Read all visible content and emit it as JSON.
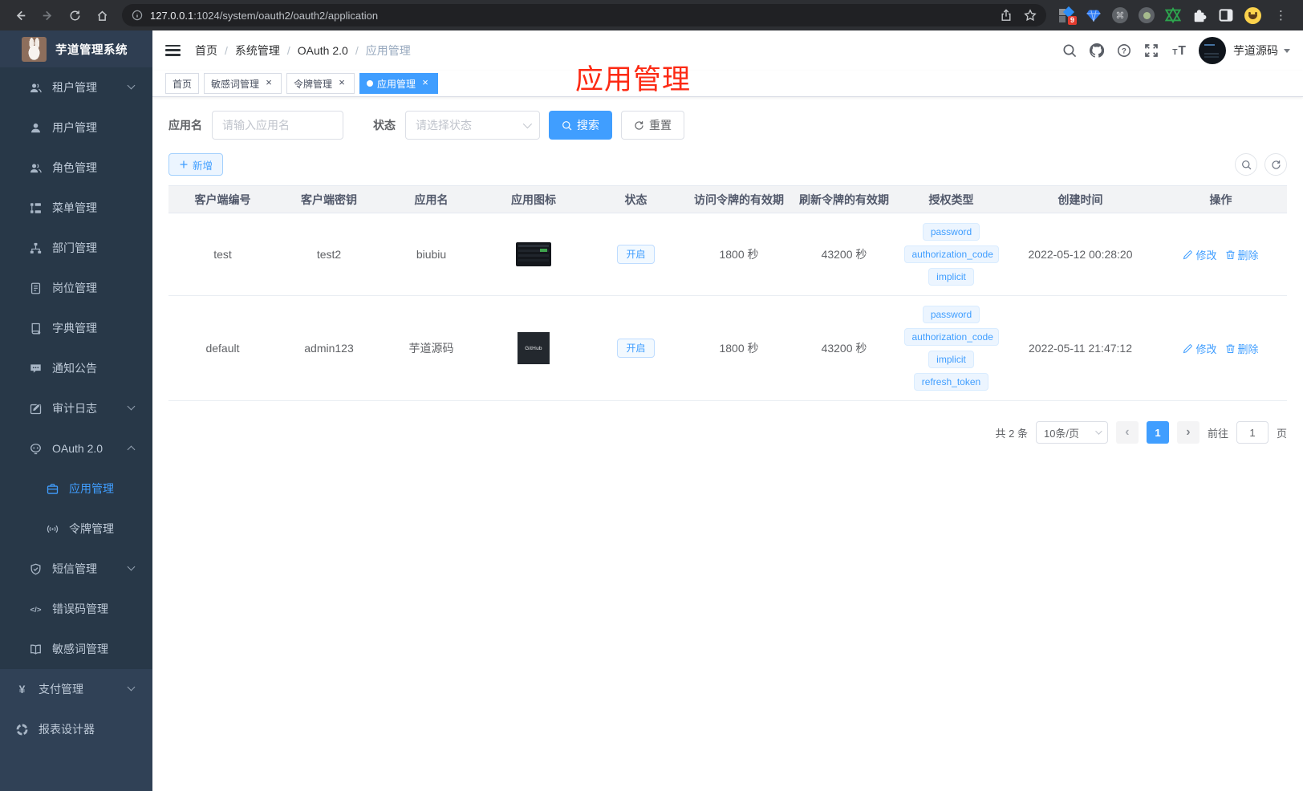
{
  "browser": {
    "url_host": "127.0.0.1",
    "url_path": ":1024/system/oauth2/oauth2/application",
    "ext_badge": "9"
  },
  "sidebar": {
    "title": "芋道管理系统",
    "items": [
      {
        "key": "tenant",
        "label": "租户管理",
        "icon": "users-icon",
        "level": "sub",
        "chevron": "down"
      },
      {
        "key": "user",
        "label": "用户管理",
        "icon": "user-icon",
        "level": "sub"
      },
      {
        "key": "role",
        "label": "角色管理",
        "icon": "users-icon",
        "level": "sub"
      },
      {
        "key": "menu",
        "label": "菜单管理",
        "icon": "menu-tree-icon",
        "level": "sub"
      },
      {
        "key": "dept",
        "label": "部门管理",
        "icon": "org-icon",
        "level": "sub"
      },
      {
        "key": "post",
        "label": "岗位管理",
        "icon": "badge-icon",
        "level": "sub"
      },
      {
        "key": "dict",
        "label": "字典管理",
        "icon": "dict-icon",
        "level": "sub"
      },
      {
        "key": "notice",
        "label": "通知公告",
        "icon": "announce-icon",
        "level": "sub"
      },
      {
        "key": "audit-log",
        "label": "审计日志",
        "icon": "log-icon",
        "level": "sub",
        "chevron": "down"
      },
      {
        "key": "oauth2",
        "label": "OAuth 2.0",
        "icon": "robot-icon",
        "level": "sub",
        "chevron": "up"
      },
      {
        "key": "oauth2-application",
        "label": "应用管理",
        "icon": "briefcase-icon",
        "level": "sub2",
        "active": true
      },
      {
        "key": "oauth2-token",
        "label": "令牌管理",
        "icon": "signal-icon",
        "level": "sub2"
      },
      {
        "key": "sms",
        "label": "短信管理",
        "icon": "shield-check-icon",
        "level": "sub",
        "chevron": "down"
      },
      {
        "key": "error-code",
        "label": "错误码管理",
        "icon": "code-icon",
        "level": "sub"
      },
      {
        "key": "sensitive-word",
        "label": "敏感词管理",
        "icon": "open-book-icon",
        "level": "sub"
      },
      {
        "key": "pay",
        "label": "支付管理",
        "icon": "yen-icon",
        "level": "top",
        "chevron": "down"
      },
      {
        "key": "report-designer",
        "label": "报表设计器",
        "icon": "report-icon",
        "level": "top"
      }
    ]
  },
  "header": {
    "breadcrumb": [
      "首页",
      "系统管理",
      "OAuth 2.0",
      "应用管理"
    ],
    "username": "芋道源码"
  },
  "annotation": {
    "text": "应用管理"
  },
  "tabs": [
    {
      "key": "home",
      "label": "首页",
      "closable": false,
      "active": false
    },
    {
      "key": "sensitive-word",
      "label": "敏感词管理",
      "closable": true,
      "active": false
    },
    {
      "key": "token",
      "label": "令牌管理",
      "closable": true,
      "active": false
    },
    {
      "key": "application",
      "label": "应用管理",
      "closable": true,
      "active": true
    }
  ],
  "filters": {
    "name_label": "应用名",
    "name_placeholder": "请输入应用名",
    "status_label": "状态",
    "status_placeholder": "请选择状态",
    "search_label": "搜索",
    "reset_label": "重置"
  },
  "toolbar": {
    "add_label": "新增"
  },
  "table": {
    "columns": [
      "客户端编号",
      "客户端密钥",
      "应用名",
      "应用图标",
      "状态",
      "访问令牌的有效期",
      "刷新令牌的有效期",
      "授权类型",
      "创建时间",
      "操作"
    ],
    "rows": [
      {
        "client_id": "test",
        "secret": "test2",
        "name": "biubiu",
        "icon": "dashboard-screenshot",
        "icon_text": "",
        "status": "开启",
        "access": "1800 秒",
        "refresh": "43200 秒",
        "grants": [
          "password",
          "authorization_code",
          "implicit"
        ],
        "created": "2022-05-12 00:28:20"
      },
      {
        "client_id": "default",
        "secret": "admin123",
        "name": "芋道源码",
        "icon": "github-dark",
        "icon_text": "GitHub",
        "status": "开启",
        "access": "1800 秒",
        "refresh": "43200 秒",
        "grants": [
          "password",
          "authorization_code",
          "implicit",
          "refresh_token"
        ],
        "created": "2022-05-11 21:47:12"
      }
    ],
    "actions": {
      "edit": "修改",
      "delete": "删除"
    }
  },
  "pagination": {
    "total": "共 2 条",
    "page_size": "10条/页",
    "current": "1",
    "goto_label": "前往",
    "goto_value": "1",
    "page_unit": "页"
  },
  "colors": {
    "accent": "#409eff",
    "sidebar_bg": "#304156",
    "annotation_red": "#fc2a14"
  }
}
